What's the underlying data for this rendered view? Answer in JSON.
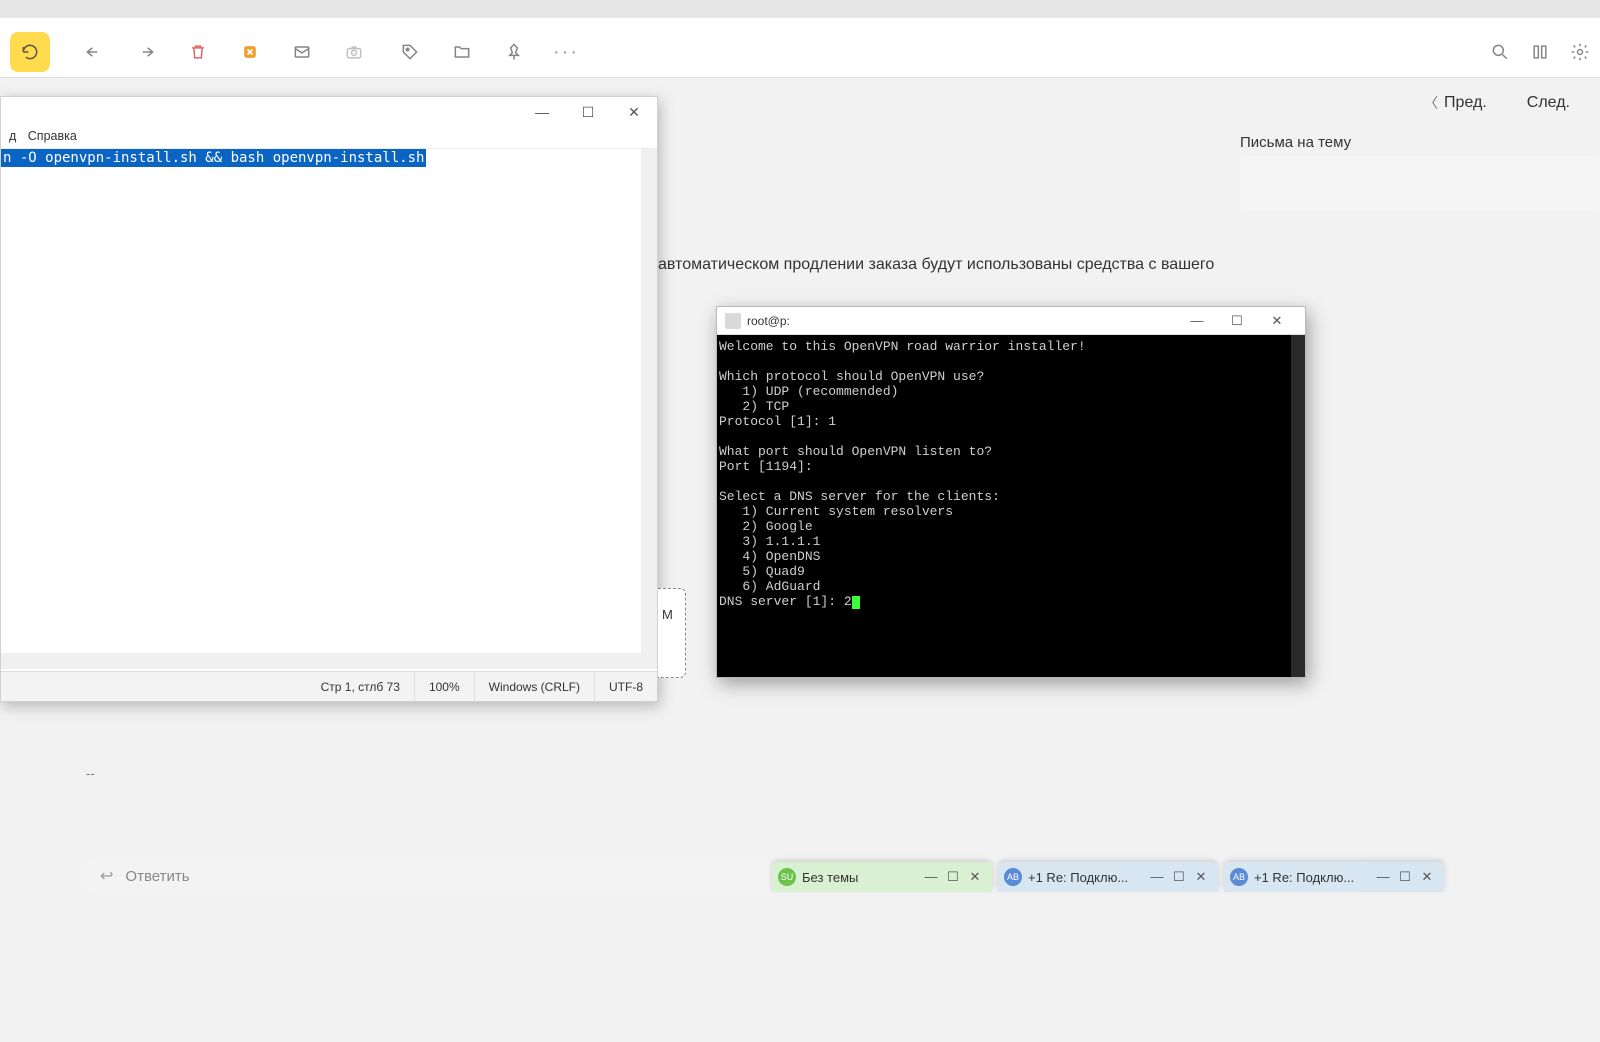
{
  "toolbar": {
    "refresh": "↻",
    "more": "···"
  },
  "nav": {
    "prev": "Пред.",
    "next": "След.",
    "subject_label": "Письма на тему"
  },
  "mail_body": {
    "line": "автоматическом продлении заказа будут использованы средства с вашего",
    "sig": "--"
  },
  "notepad": {
    "menu_item_1": "д",
    "menu_item_2": "Справка",
    "selected_text": "n -O openvpn-install.sh && bash openvpn-install.sh",
    "status": {
      "pos": "Стр 1, стлб 73",
      "zoom": "100%",
      "eol": "Windows (CRLF)",
      "enc": "UTF-8"
    },
    "attach_letter": "М"
  },
  "ssh": {
    "title": "root@p:",
    "lines": [
      "Welcome to this OpenVPN road warrior installer!",
      "",
      "Which protocol should OpenVPN use?",
      "   1) UDP (recommended)",
      "   2) TCP",
      "Protocol [1]: 1",
      "",
      "What port should OpenVPN listen to?",
      "Port [1194]:",
      "",
      "Select a DNS server for the clients:",
      "   1) Current system resolvers",
      "   2) Google",
      "   3) 1.1.1.1",
      "   4) OpenDNS",
      "   5) Quad9",
      "   6) AdGuard"
    ],
    "prompt": "DNS server [1]: ",
    "input": "2"
  },
  "reply": {
    "placeholder": "Ответить"
  },
  "chats": {
    "c1": {
      "avatar": "SU",
      "title": "Без темы"
    },
    "c2": {
      "avatar": "АВ",
      "title": "+1  Re: Подклю..."
    },
    "c3": {
      "avatar": "АВ",
      "title": "+1  Re: Подклю..."
    }
  }
}
